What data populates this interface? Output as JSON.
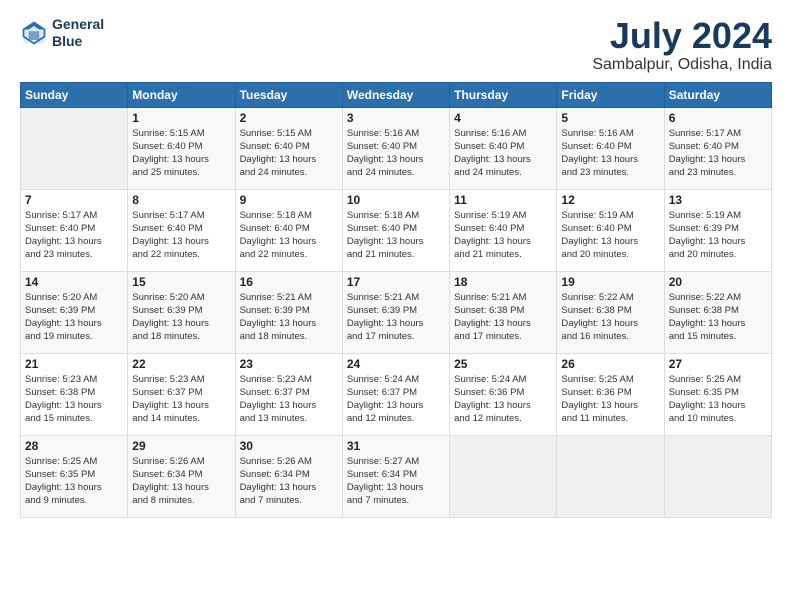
{
  "header": {
    "logo_line1": "General",
    "logo_line2": "Blue",
    "title": "July 2024",
    "subtitle": "Sambalpur, Odisha, India"
  },
  "days_of_week": [
    "Sunday",
    "Monday",
    "Tuesday",
    "Wednesday",
    "Thursday",
    "Friday",
    "Saturday"
  ],
  "weeks": [
    [
      {
        "day": "",
        "info": ""
      },
      {
        "day": "1",
        "info": "Sunrise: 5:15 AM\nSunset: 6:40 PM\nDaylight: 13 hours\nand 25 minutes."
      },
      {
        "day": "2",
        "info": "Sunrise: 5:15 AM\nSunset: 6:40 PM\nDaylight: 13 hours\nand 24 minutes."
      },
      {
        "day": "3",
        "info": "Sunrise: 5:16 AM\nSunset: 6:40 PM\nDaylight: 13 hours\nand 24 minutes."
      },
      {
        "day": "4",
        "info": "Sunrise: 5:16 AM\nSunset: 6:40 PM\nDaylight: 13 hours\nand 24 minutes."
      },
      {
        "day": "5",
        "info": "Sunrise: 5:16 AM\nSunset: 6:40 PM\nDaylight: 13 hours\nand 23 minutes."
      },
      {
        "day": "6",
        "info": "Sunrise: 5:17 AM\nSunset: 6:40 PM\nDaylight: 13 hours\nand 23 minutes."
      }
    ],
    [
      {
        "day": "7",
        "info": "Sunrise: 5:17 AM\nSunset: 6:40 PM\nDaylight: 13 hours\nand 23 minutes."
      },
      {
        "day": "8",
        "info": "Sunrise: 5:17 AM\nSunset: 6:40 PM\nDaylight: 13 hours\nand 22 minutes."
      },
      {
        "day": "9",
        "info": "Sunrise: 5:18 AM\nSunset: 6:40 PM\nDaylight: 13 hours\nand 22 minutes."
      },
      {
        "day": "10",
        "info": "Sunrise: 5:18 AM\nSunset: 6:40 PM\nDaylight: 13 hours\nand 21 minutes."
      },
      {
        "day": "11",
        "info": "Sunrise: 5:19 AM\nSunset: 6:40 PM\nDaylight: 13 hours\nand 21 minutes."
      },
      {
        "day": "12",
        "info": "Sunrise: 5:19 AM\nSunset: 6:40 PM\nDaylight: 13 hours\nand 20 minutes."
      },
      {
        "day": "13",
        "info": "Sunrise: 5:19 AM\nSunset: 6:39 PM\nDaylight: 13 hours\nand 20 minutes."
      }
    ],
    [
      {
        "day": "14",
        "info": "Sunrise: 5:20 AM\nSunset: 6:39 PM\nDaylight: 13 hours\nand 19 minutes."
      },
      {
        "day": "15",
        "info": "Sunrise: 5:20 AM\nSunset: 6:39 PM\nDaylight: 13 hours\nand 18 minutes."
      },
      {
        "day": "16",
        "info": "Sunrise: 5:21 AM\nSunset: 6:39 PM\nDaylight: 13 hours\nand 18 minutes."
      },
      {
        "day": "17",
        "info": "Sunrise: 5:21 AM\nSunset: 6:39 PM\nDaylight: 13 hours\nand 17 minutes."
      },
      {
        "day": "18",
        "info": "Sunrise: 5:21 AM\nSunset: 6:38 PM\nDaylight: 13 hours\nand 17 minutes."
      },
      {
        "day": "19",
        "info": "Sunrise: 5:22 AM\nSunset: 6:38 PM\nDaylight: 13 hours\nand 16 minutes."
      },
      {
        "day": "20",
        "info": "Sunrise: 5:22 AM\nSunset: 6:38 PM\nDaylight: 13 hours\nand 15 minutes."
      }
    ],
    [
      {
        "day": "21",
        "info": "Sunrise: 5:23 AM\nSunset: 6:38 PM\nDaylight: 13 hours\nand 15 minutes."
      },
      {
        "day": "22",
        "info": "Sunrise: 5:23 AM\nSunset: 6:37 PM\nDaylight: 13 hours\nand 14 minutes."
      },
      {
        "day": "23",
        "info": "Sunrise: 5:23 AM\nSunset: 6:37 PM\nDaylight: 13 hours\nand 13 minutes."
      },
      {
        "day": "24",
        "info": "Sunrise: 5:24 AM\nSunset: 6:37 PM\nDaylight: 13 hours\nand 12 minutes."
      },
      {
        "day": "25",
        "info": "Sunrise: 5:24 AM\nSunset: 6:36 PM\nDaylight: 13 hours\nand 12 minutes."
      },
      {
        "day": "26",
        "info": "Sunrise: 5:25 AM\nSunset: 6:36 PM\nDaylight: 13 hours\nand 11 minutes."
      },
      {
        "day": "27",
        "info": "Sunrise: 5:25 AM\nSunset: 6:35 PM\nDaylight: 13 hours\nand 10 minutes."
      }
    ],
    [
      {
        "day": "28",
        "info": "Sunrise: 5:25 AM\nSunset: 6:35 PM\nDaylight: 13 hours\nand 9 minutes."
      },
      {
        "day": "29",
        "info": "Sunrise: 5:26 AM\nSunset: 6:34 PM\nDaylight: 13 hours\nand 8 minutes."
      },
      {
        "day": "30",
        "info": "Sunrise: 5:26 AM\nSunset: 6:34 PM\nDaylight: 13 hours\nand 7 minutes."
      },
      {
        "day": "31",
        "info": "Sunrise: 5:27 AM\nSunset: 6:34 PM\nDaylight: 13 hours\nand 7 minutes."
      },
      {
        "day": "",
        "info": ""
      },
      {
        "day": "",
        "info": ""
      },
      {
        "day": "",
        "info": ""
      }
    ]
  ]
}
